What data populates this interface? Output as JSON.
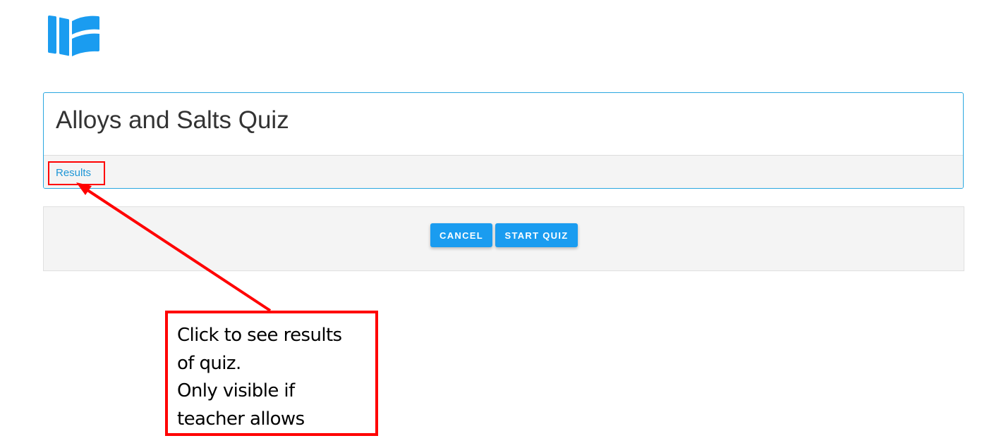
{
  "app": {
    "logo_icon": "open-book-logo-icon",
    "brand_color": "#1a9cf0"
  },
  "quiz": {
    "title": "Alloys and Salts Quiz",
    "results_link": "Results"
  },
  "actions": {
    "cancel_label": "CANCEL",
    "start_label": "START QUIZ"
  },
  "annotation": {
    "lines": [
      "Click to see results",
      "of quiz.",
      "Only visible if",
      "teacher allows"
    ],
    "color": "#ff0000"
  }
}
